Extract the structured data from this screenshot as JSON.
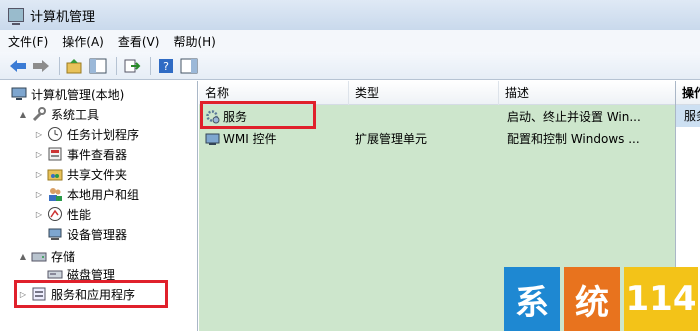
{
  "window": {
    "title": "计算机管理"
  },
  "menu": [
    "文件(F)",
    "操作(A)",
    "查看(V)",
    "帮助(H)"
  ],
  "tree": [
    {
      "label": "计算机管理(本地)",
      "icon": "computer-icon",
      "level": 0,
      "arrow": ""
    },
    {
      "label": "系统工具",
      "icon": "tools-icon",
      "level": 1,
      "arrow": "▲"
    },
    {
      "label": "任务计划程序",
      "icon": "clock-icon",
      "level": 2,
      "arrow": "▷"
    },
    {
      "label": "事件查看器",
      "icon": "event-viewer-icon",
      "level": 2,
      "arrow": "▷"
    },
    {
      "label": "共享文件夹",
      "icon": "shared-folder-icon",
      "level": 2,
      "arrow": "▷"
    },
    {
      "label": "本地用户和组",
      "icon": "users-icon",
      "level": 2,
      "arrow": "▷"
    },
    {
      "label": "性能",
      "icon": "performance-icon",
      "level": 2,
      "arrow": "▷"
    },
    {
      "label": "设备管理器",
      "icon": "device-manager-icon",
      "level": 2,
      "arrow": ""
    },
    {
      "label": "存储",
      "icon": "storage-icon",
      "level": 1,
      "arrow": "▲"
    },
    {
      "label": "磁盘管理",
      "icon": "disk-icon",
      "level": 2,
      "arrow": ""
    },
    {
      "label": "服务和应用程序",
      "icon": "services-apps-icon",
      "level": 1,
      "arrow": "▷"
    }
  ],
  "columns": {
    "name": "名称",
    "type": "类型",
    "description": "描述"
  },
  "rows": [
    {
      "name": "服务",
      "type": "",
      "description": "启动、终止并设置 Win...",
      "icon": "services-gear-icon"
    },
    {
      "name": "WMI 控件",
      "type": "扩展管理单元",
      "description": "配置和控制 Windows ...",
      "icon": "wmi-icon"
    }
  ],
  "actions": {
    "header": "操作",
    "item": "服务"
  },
  "watermark": {
    "chars": [
      "系",
      "统",
      "114"
    ],
    "colors": [
      "#1e88d2",
      "#e8731e",
      "#f3c318"
    ]
  },
  "colors": {
    "list_background": "#cde6cc",
    "highlight": "#e0202b"
  }
}
